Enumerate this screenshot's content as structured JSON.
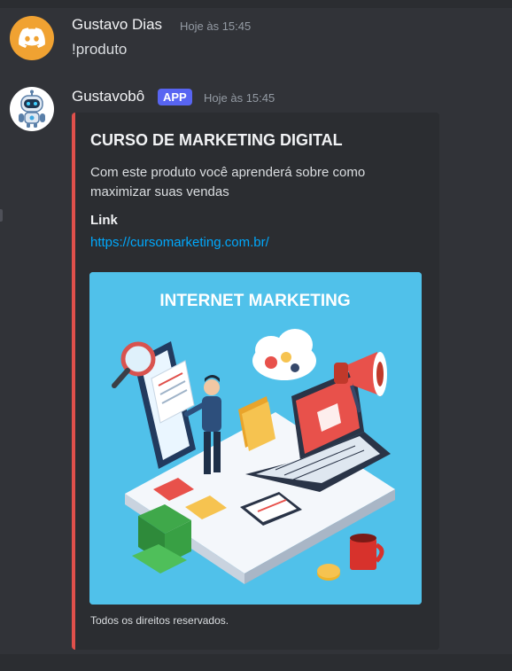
{
  "messages": [
    {
      "username": "Gustavo Dias",
      "timestamp": "Hoje às 15:45",
      "content": "!produto",
      "avatar_icon": "discord-logo-icon",
      "avatar_color": "#f0a232"
    },
    {
      "username": "Gustavobô",
      "badge": "APP",
      "timestamp": "Hoje às 15:45",
      "avatar_icon": "robot-icon",
      "embed": {
        "accent_color": "#e0504b",
        "title": "CURSO DE MARKETING DIGITAL",
        "description": "Com este produto você aprenderá sobre como maximizar suas vendas",
        "field_name": "Link",
        "field_value": "https://cursomarketing.com.br/",
        "image_title": "INTERNET MARKETING",
        "footer": "Todos os direitos reservados."
      }
    }
  ],
  "colors": {
    "background": "#313338",
    "embed_background": "#2b2d31",
    "link": "#00a8fc",
    "app_badge": "#5865f2"
  }
}
